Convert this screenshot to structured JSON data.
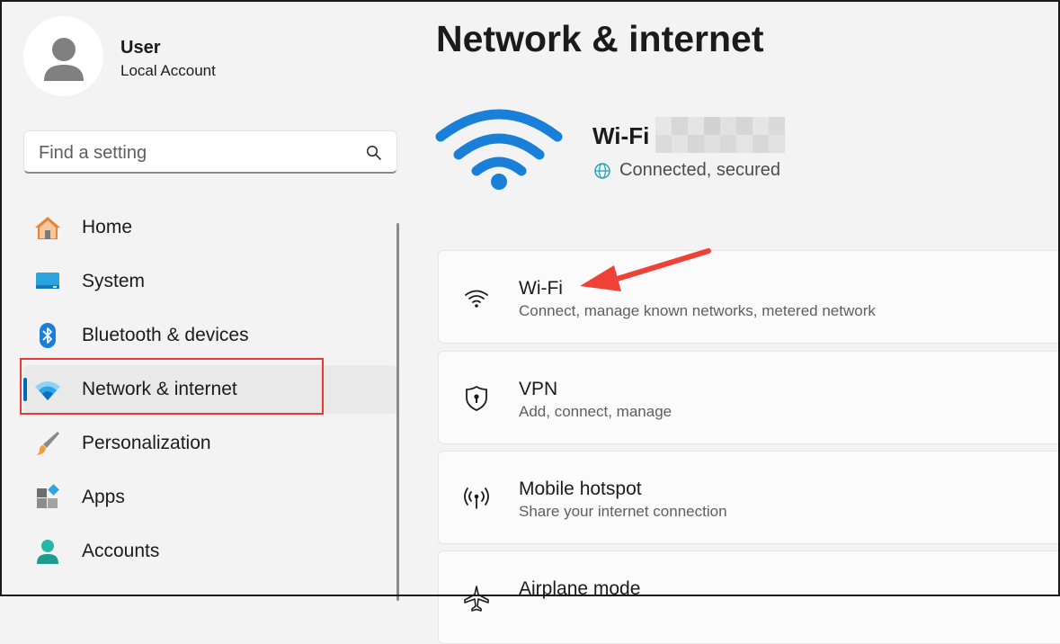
{
  "user": {
    "name": "User",
    "account_type": "Local Account"
  },
  "search": {
    "placeholder": "Find a setting"
  },
  "nav": {
    "items": [
      {
        "label": "Home"
      },
      {
        "label": "System"
      },
      {
        "label": "Bluetooth & devices"
      },
      {
        "label": "Network & internet",
        "selected": true
      },
      {
        "label": "Personalization"
      },
      {
        "label": "Apps"
      },
      {
        "label": "Accounts"
      }
    ]
  },
  "page": {
    "title": "Network & internet"
  },
  "connection": {
    "name": "Wi-Fi",
    "status": "Connected, secured"
  },
  "cards": [
    {
      "title": "Wi-Fi",
      "subtitle": "Connect, manage known networks, metered network",
      "icon": "wifi-icon"
    },
    {
      "title": "VPN",
      "subtitle": "Add, connect, manage",
      "icon": "shield-icon"
    },
    {
      "title": "Mobile hotspot",
      "subtitle": "Share your internet connection",
      "icon": "hotspot-icon"
    },
    {
      "title": "Airplane mode",
      "subtitle": "",
      "icon": "airplane-icon"
    }
  ],
  "colors": {
    "accent": "#0067c0",
    "annotation": "#e53935"
  }
}
